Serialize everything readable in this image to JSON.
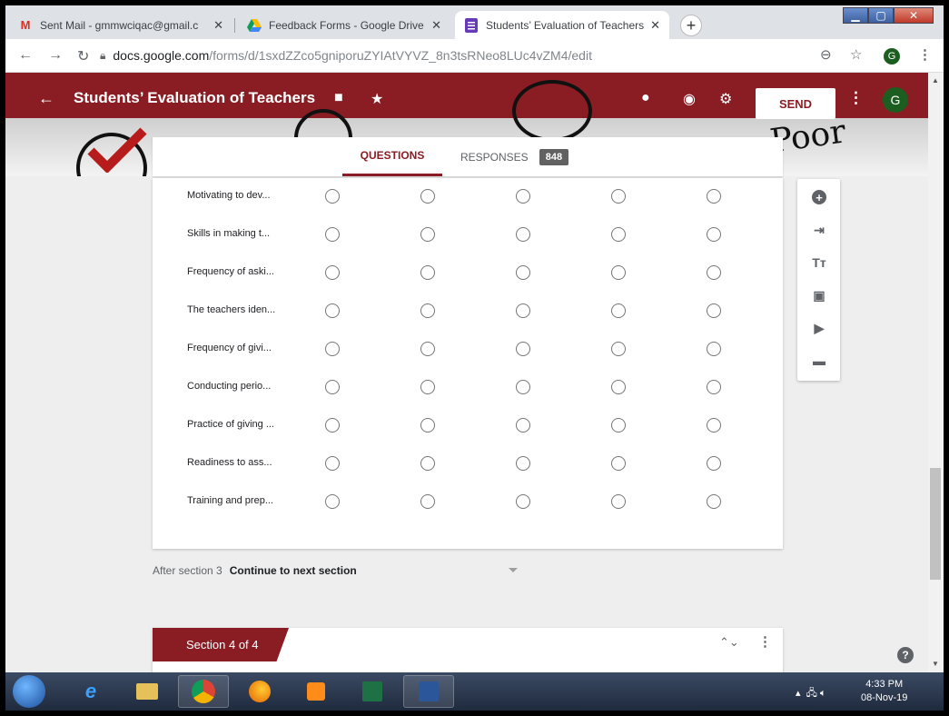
{
  "browser": {
    "tabs": [
      {
        "title": "Sent Mail - gmmwciqac@gmail.c",
        "icon": "gmail-icon"
      },
      {
        "title": "Feedback Forms - Google Drive",
        "icon": "drive-icon"
      },
      {
        "title": "Students’ Evaluation of Teachers",
        "icon": "forms-icon",
        "active": true
      }
    ],
    "url_host": "docs.google.com",
    "url_path": "/forms/d/1sxdZZco5gniporuZYIAtVYVZ_8n3tsRNeo8LUc4vZM4/edit",
    "profile_initial": "G"
  },
  "form": {
    "title": "Students’ Evaluation of Teachers",
    "send_label": "SEND",
    "avatar_initial": "G",
    "header_word": "Poor",
    "tabs": {
      "questions": "QUESTIONS",
      "responses": "RESPONSES",
      "responses_count": "848"
    },
    "rows": [
      "Motivating to dev...",
      "Skills in making t...",
      "Frequency of aski...",
      "The teachers iden...",
      "Frequency of givi...",
      "Conducting perio...",
      "Practice of giving ...",
      "Readiness to ass...",
      "Training and prep..."
    ],
    "after_section_label": "After section 3",
    "after_section_value": "Continue to next section",
    "next_section_title": "Section 4 of 4"
  },
  "taskbar": {
    "time": "4:33 PM",
    "date": "08-Nov-19"
  }
}
